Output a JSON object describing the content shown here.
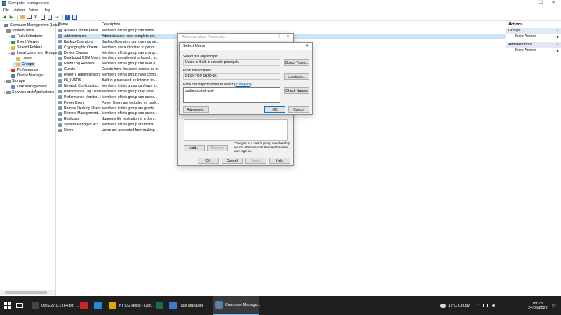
{
  "window": {
    "title": "Computer Management",
    "minimize": "—",
    "maximize": "☐",
    "close": "✕"
  },
  "menu": [
    "File",
    "Action",
    "View",
    "Help"
  ],
  "tree": [
    {
      "label": "Computer Management (Local",
      "indent": 0,
      "arrow": "",
      "icon": "computer-icon"
    },
    {
      "label": "System Tools",
      "indent": 1,
      "arrow": "⌄",
      "icon": "tools-icon"
    },
    {
      "label": "Task Scheduler",
      "indent": 2,
      "arrow": "›",
      "icon": "clock-icon"
    },
    {
      "label": "Event Viewer",
      "indent": 2,
      "arrow": "›",
      "icon": "event-icon"
    },
    {
      "label": "Shared Folders",
      "indent": 2,
      "arrow": "›",
      "icon": "folder-icon"
    },
    {
      "label": "Local Users and Groups",
      "indent": 2,
      "arrow": "⌄",
      "icon": "users-icon"
    },
    {
      "label": "Users",
      "indent": 3,
      "arrow": "",
      "icon": "folder-icon"
    },
    {
      "label": "Groups",
      "indent": 3,
      "arrow": "",
      "icon": "folder-icon",
      "selected": true
    },
    {
      "label": "Performance",
      "indent": 2,
      "arrow": "›",
      "icon": "perf-icon"
    },
    {
      "label": "Device Manager",
      "indent": 2,
      "arrow": "",
      "icon": "device-icon"
    },
    {
      "label": "Storage",
      "indent": 1,
      "arrow": "⌄",
      "icon": "storage-icon"
    },
    {
      "label": "Disk Management",
      "indent": 2,
      "arrow": "",
      "icon": "disk-icon"
    },
    {
      "label": "Services and Applications",
      "indent": 1,
      "arrow": "›",
      "icon": "services-icon"
    }
  ],
  "list": {
    "col_name": "Name",
    "col_desc": "Description",
    "rows": [
      {
        "name": "Access Control Assist...",
        "desc": "Members of this group can remot..."
      },
      {
        "name": "Administrators",
        "desc": "Administrators have complete an...",
        "selected": true
      },
      {
        "name": "Backup Operators",
        "desc": "Backup Operators can override se..."
      },
      {
        "name": "Cryptographic Operat...",
        "desc": "Members are authorized to perfor..."
      },
      {
        "name": "Device Owners",
        "desc": "Members of this group can chang..."
      },
      {
        "name": "Distributed COM Users",
        "desc": "Members are allowed to launch, a..."
      },
      {
        "name": "Event Log Readers",
        "desc": "Members of this group can read e..."
      },
      {
        "name": "Guests",
        "desc": "Guests have the same access as m..."
      },
      {
        "name": "Hyper-V Administrators",
        "desc": "Members of this group have comp..."
      },
      {
        "name": "IIS_IUSRS",
        "desc": "Built-in group used by Internet Inf..."
      },
      {
        "name": "Network Configuratio...",
        "desc": "Members in this group can have s..."
      },
      {
        "name": "Performance Log Users",
        "desc": "Members of this group may sche..."
      },
      {
        "name": "Performance Monitor ...",
        "desc": "Members of this group can acces..."
      },
      {
        "name": "Power Users",
        "desc": "Power Users are included for back..."
      },
      {
        "name": "Remote Desktop Users",
        "desc": "Members in this group are grante..."
      },
      {
        "name": "Remote Management...",
        "desc": "Members of this group can acces..."
      },
      {
        "name": "Replicator",
        "desc": "Supports file replication in a dom..."
      },
      {
        "name": "System Managed Acc...",
        "desc": "Members of this group are mana..."
      },
      {
        "name": "Users",
        "desc": "Users are prevented from making ..."
      }
    ]
  },
  "actions": {
    "title": "Actions",
    "sections": [
      {
        "name": "Groups",
        "item": "More Actions"
      },
      {
        "name": "Administrators",
        "item": "More Actions"
      }
    ]
  },
  "props_dialog": {
    "title": "Administrators Properties",
    "help": "?",
    "close": "✕",
    "add": "Add...",
    "remove": "Remove",
    "note": "Changes to a user's group membership are not effective until the next time the user logs on.",
    "ok": "OK",
    "cancel": "Cancel",
    "apply": "Apply",
    "help_btn": "Help"
  },
  "select_dialog": {
    "title": "Select Users",
    "close": "✕",
    "type_label": "Select this object type:",
    "type_value": "Users or Built-in security principals",
    "type_btn": "Object Types...",
    "loc_label": "From this location:",
    "loc_value": "DESKTOP-1BJDN01",
    "loc_btn": "Locations...",
    "names_label_prefix": "Enter the object names to select (",
    "names_label_link": "examples",
    "names_label_suffix": "):",
    "names_value": "authenticated usel",
    "check_btn": "Check Names",
    "advanced_btn": "Advanced...",
    "ok": "OK",
    "cancel": "Cancel"
  },
  "taskbar": {
    "apps": [
      {
        "label": "OBS 27.0.1 (64-bit, ...",
        "color": "#444444",
        "icon": "obs-icon"
      },
      {
        "label": "",
        "color": "#c62828",
        "icon": "filezilla-icon"
      },
      {
        "label": "",
        "color": "#2b88d8",
        "icon": "chat-icon"
      },
      {
        "label": "YT CG Hitlist - Goo...",
        "color": "#e0a800",
        "icon": "chrome-icon"
      },
      {
        "label": "",
        "color": "#1b6e4c",
        "icon": "media-icon"
      },
      {
        "label": "Task Manager",
        "color": "#3a7bd5",
        "icon": "taskmgr-icon"
      },
      {
        "label": "Computer Manage...",
        "color": "#5b7fa8",
        "icon": "compmgmt-icon",
        "active": true
      }
    ],
    "weather": "17°C  Cloudy",
    "time": "09:23",
    "date": "24/06/2022"
  }
}
